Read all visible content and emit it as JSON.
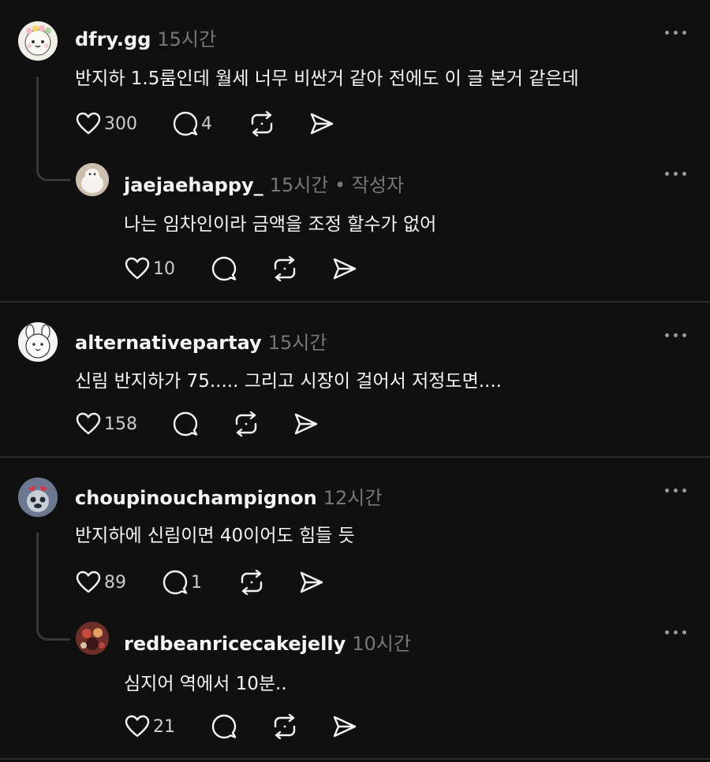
{
  "comments": [
    {
      "username": "dfry.gg",
      "time": "15시간",
      "text": "반지하 1.5룸인데 월세 너무 비싼거 같아 전에도 이 글 본거 같은데",
      "likes": "300",
      "replies": "4"
    },
    {
      "username": "jaejaehappy_",
      "time": "15시간",
      "tag": " • 작성자",
      "text": "나는 임차인이라 금액을 조정 할수가 없어",
      "likes": "10",
      "replies": ""
    },
    {
      "username": "alternativepartay",
      "time": "15시간",
      "text": "신림 반지하가 75..... 그리고 시장이 걸어서 저정도면....",
      "likes": "158",
      "replies": ""
    },
    {
      "username": "choupinouchampignon",
      "time": "12시간",
      "text": "반지하에 신림이면 40이어도 힘들 듯",
      "likes": "89",
      "replies": "1"
    },
    {
      "username": "redbeanricecakejelly",
      "time": "10시간",
      "text": "심지어 역에서 10분..",
      "likes": "21",
      "replies": ""
    }
  ],
  "colors": {
    "background": "#101010",
    "text": "#f3f5f7",
    "muted": "#777777",
    "divider": "#2a2a2a"
  },
  "icons": [
    "heart-icon",
    "comment-icon",
    "repost-icon",
    "share-icon",
    "more-icon"
  ]
}
